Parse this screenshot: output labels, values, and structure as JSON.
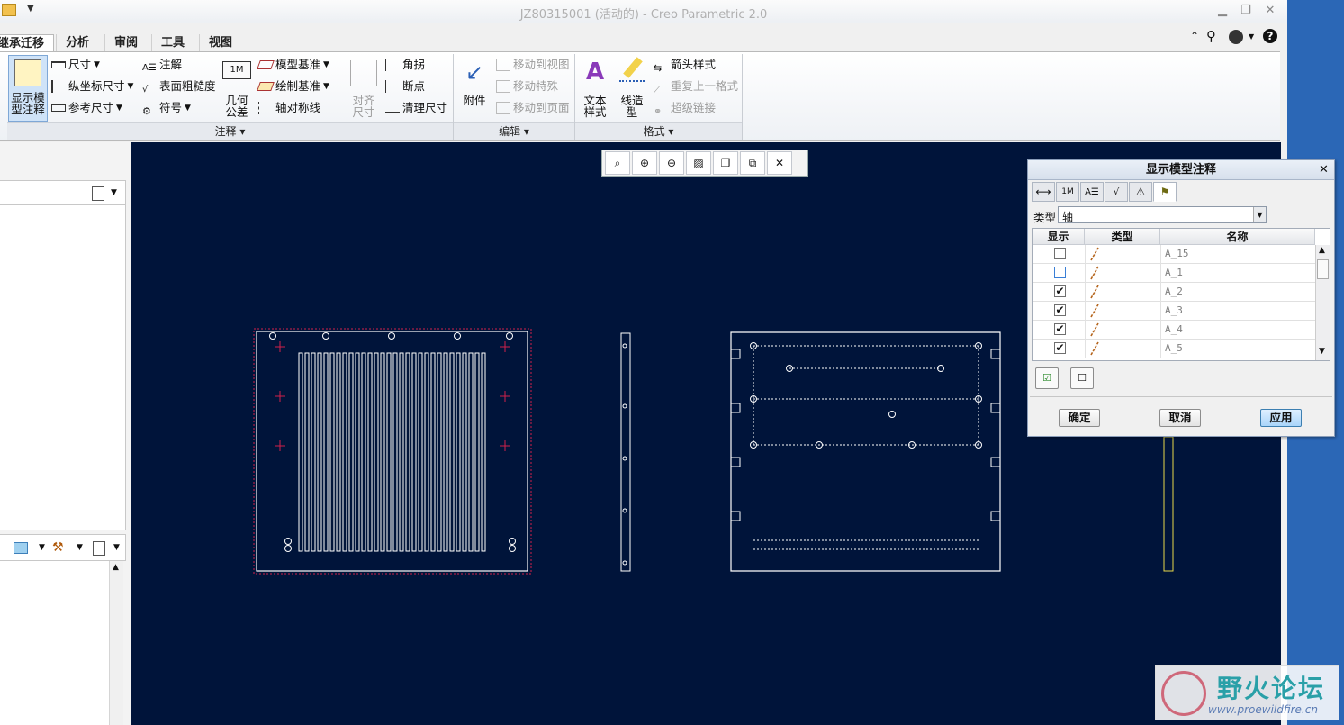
{
  "window": {
    "title": "JZ80315001 (活动的) - Creo Parametric 2.0"
  },
  "tabs": [
    {
      "label": "继承迁移"
    },
    {
      "label": "分析"
    },
    {
      "label": "审阅"
    },
    {
      "label": "工具"
    },
    {
      "label": "视图"
    }
  ],
  "ribbon": {
    "annotate": {
      "footer": "注释 ▾",
      "show_model_annotations": "显示模\n型注释",
      "dimension": "尺寸",
      "ordinate_dimension": "纵坐标尺寸",
      "reference_dimension": "参考尺寸",
      "note": "注解",
      "surface_finish": "表面粗糙度",
      "symbol": "符号",
      "geometric_tolerance": "几何\n公差",
      "model_datum": "模型基准",
      "sketch_datum": "绘制基准",
      "axis_symmetry": "轴对称线",
      "align_dimensions": "对齐\n尺寸",
      "jog": "角拐",
      "breakpoint": "断点",
      "cleanup_dimensions": "清理尺寸"
    },
    "edit": {
      "footer": "编辑 ▾",
      "attachment": "附件",
      "move_to_view": "移动到视图",
      "move_special": "移动特殊",
      "move_to_page": "移动到页面"
    },
    "format": {
      "footer": "格式 ▾",
      "text_style": "文本\n样式",
      "line_style": "线造\n型",
      "arrow_style": "箭头样式",
      "repeat_last_format": "重复上一格式",
      "hyperlink": "超级链接"
    }
  },
  "dialog": {
    "title": "显示模型注释",
    "type_label": "类型",
    "type_value": "轴",
    "columns": [
      "显示",
      "类型",
      "名称"
    ],
    "rows": [
      {
        "show": false,
        "name": "A_15"
      },
      {
        "show": false,
        "name": "A_1"
      },
      {
        "show": true,
        "name": "A_2"
      },
      {
        "show": true,
        "name": "A_3"
      },
      {
        "show": true,
        "name": "A_4"
      },
      {
        "show": true,
        "name": "A_5"
      }
    ],
    "check_mark": "✔",
    "ok": "确定",
    "cancel": "取消",
    "apply": "应用"
  },
  "watermark": {
    "text": "野火论坛",
    "url": "www.proewildfire.cn"
  },
  "colors": {
    "canvas": "#00143a",
    "drawing_line": "#ffffff",
    "datum_red": "#d0204a",
    "window_frame": "#2b67b6"
  }
}
